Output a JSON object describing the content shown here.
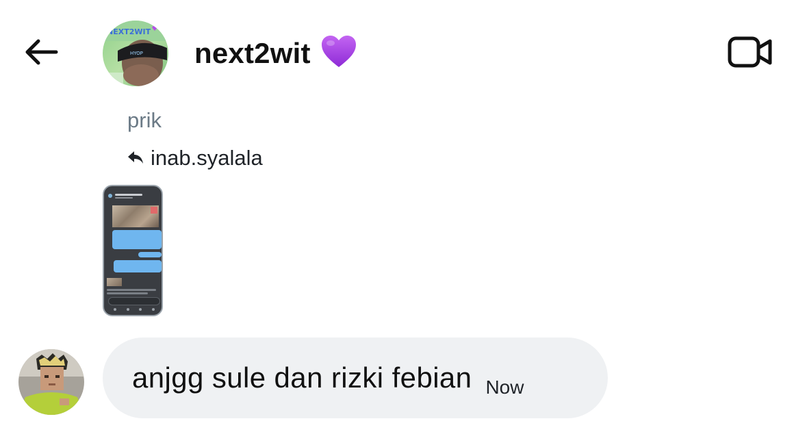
{
  "header": {
    "back_icon": "arrow-left-icon",
    "username": "next2wit",
    "emoji": "💜",
    "video_icon": "video-camera-icon",
    "avatar_caption": "NEXT2WIT"
  },
  "reply": {
    "label": "prik",
    "reply_icon": "reply-arrow-icon",
    "replied_to": "inab.syalala"
  },
  "shared_media": {
    "type": "screenshot-thumbnail"
  },
  "message": {
    "text": "anjgg sule dan rizki febian",
    "time": "Now"
  },
  "colors": {
    "bubble": "#eff1f3",
    "reply_label": "#6b7a86",
    "heart": "#a23ce6"
  }
}
